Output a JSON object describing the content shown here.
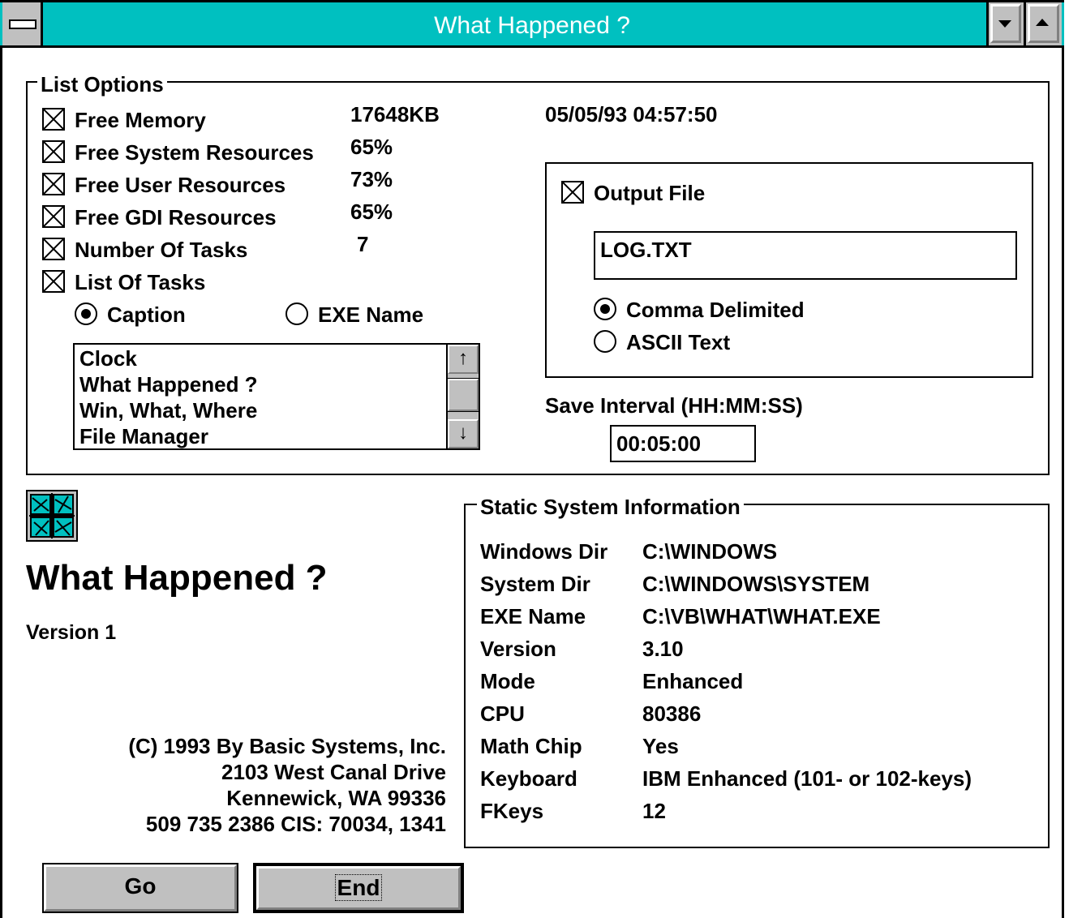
{
  "window": {
    "title": "What Happened ?",
    "titlebar_color": "#00c0c0"
  },
  "list_options": {
    "group_label": "List Options",
    "timestamp": "05/05/93 04:57:50",
    "items": [
      {
        "label": "Free Memory",
        "checked": true,
        "value": "17648KB"
      },
      {
        "label": "Free System Resources",
        "checked": true,
        "value": "65%"
      },
      {
        "label": "Free User Resources",
        "checked": true,
        "value": "73%"
      },
      {
        "label": "Free GDI Resources",
        "checked": true,
        "value": "65%"
      },
      {
        "label": "Number Of Tasks",
        "checked": true,
        "value": "7"
      },
      {
        "label": "List Of Tasks",
        "checked": true,
        "value": ""
      }
    ],
    "radio_caption": "Caption",
    "radio_exe": "EXE Name",
    "radio_selected": "Caption",
    "tasks": [
      "Clock",
      "What Happened ?",
      "Win, What, Where",
      "File Manager"
    ],
    "scroll_up": "↑",
    "scroll_down": "↓"
  },
  "output": {
    "checkbox_label": "Output File",
    "checked": true,
    "filename": "LOG.TXT",
    "radio_comma": "Comma Delimited",
    "radio_ascii": "ASCII Text",
    "radio_selected": "Comma Delimited",
    "save_interval_label": "Save Interval (HH:MM:SS)",
    "save_interval_value": "00:05:00"
  },
  "about": {
    "title": "What Happened ?",
    "version": "Version 1",
    "address": [
      "(C) 1993 By Basic Systems, Inc.",
      "2103 West Canal Drive",
      "Kennewick, WA 99336",
      "509 735 2386  CIS: 70034, 1341"
    ]
  },
  "static_info": {
    "group_label": "Static System Information",
    "rows": [
      {
        "label": "Windows Dir",
        "value": "C:\\WINDOWS"
      },
      {
        "label": "System Dir",
        "value": "C:\\WINDOWS\\SYSTEM"
      },
      {
        "label": "EXE Name",
        "value": "C:\\VB\\WHAT\\WHAT.EXE"
      },
      {
        "label": "Version",
        "value": "3.10"
      },
      {
        "label": "Mode",
        "value": "Enhanced"
      },
      {
        "label": "CPU",
        "value": "80386"
      },
      {
        "label": "Math Chip",
        "value": "Yes"
      },
      {
        "label": "Keyboard",
        "value": "IBM Enhanced (101- or 102-keys)"
      },
      {
        "label": "FKeys",
        "value": "12"
      }
    ]
  },
  "buttons": {
    "go": "Go",
    "end": "End"
  }
}
